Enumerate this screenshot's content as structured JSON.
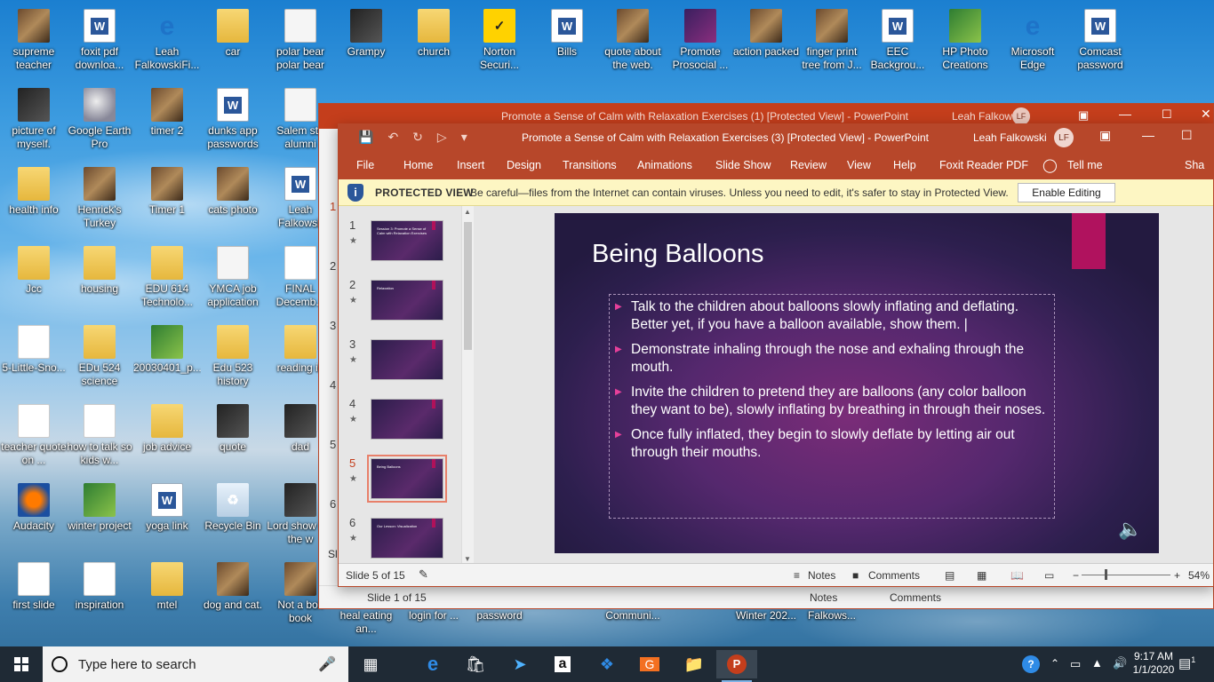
{
  "desktop_icons": [
    {
      "label": "supreme teacher",
      "type": "photo"
    },
    {
      "label": "foxit pdf downloa...",
      "type": "word"
    },
    {
      "label": "Leah FalkowskiFi...",
      "type": "edge"
    },
    {
      "label": "car",
      "type": "folder"
    },
    {
      "label": "polar bear polar bear",
      "type": "doc"
    },
    {
      "label": "Grampy",
      "type": "dark"
    },
    {
      "label": "church",
      "type": "folder"
    },
    {
      "label": "Norton Securi...",
      "type": "norton"
    },
    {
      "label": "Bills",
      "type": "word"
    },
    {
      "label": "quote about the web.",
      "type": "photo"
    },
    {
      "label": "Promote Prosocial ...",
      "type": "ppt"
    },
    {
      "label": "action packed",
      "type": "photo"
    },
    {
      "label": "finger print tree from J...",
      "type": "photo"
    },
    {
      "label": "EEC Backgrou...",
      "type": "word"
    },
    {
      "label": "HP Photo Creations",
      "type": "green"
    },
    {
      "label": "Microsoft Edge",
      "type": "edge"
    },
    {
      "label": "Comcast password",
      "type": "word"
    },
    {
      "label": "picture of myself.",
      "type": "dark"
    },
    {
      "label": "Google Earth Pro",
      "type": "earth"
    },
    {
      "label": "timer 2",
      "type": "photo"
    },
    {
      "label": "dunks app passwords",
      "type": "word"
    },
    {
      "label": "Salem sta alumni",
      "type": "doc"
    },
    {
      "label": "health info",
      "type": "folder"
    },
    {
      "label": "Henrick's Turkey",
      "type": "photo"
    },
    {
      "label": "Timer 1",
      "type": "photo"
    },
    {
      "label": "cats photo",
      "type": "photo"
    },
    {
      "label": "Leah Falkowsk",
      "type": "word"
    },
    {
      "label": "Jcc",
      "type": "folder"
    },
    {
      "label": "housing",
      "type": "folder"
    },
    {
      "label": "EDU 614 Technolo...",
      "type": "folder"
    },
    {
      "label": "YMCA job application",
      "type": "doc"
    },
    {
      "label": "FINAL Decemb...",
      "type": "white"
    },
    {
      "label": "5-Little-Sno...",
      "type": "white"
    },
    {
      "label": "EDu 524 science",
      "type": "folder"
    },
    {
      "label": "20030401_p...",
      "type": "green"
    },
    {
      "label": "Edu 523 history",
      "type": "folder"
    },
    {
      "label": "reading in",
      "type": "folder"
    },
    {
      "label": "teacher quote on ...",
      "type": "white"
    },
    {
      "label": "how to talk so kids w...",
      "type": "white"
    },
    {
      "label": "job advice",
      "type": "folder"
    },
    {
      "label": "quote",
      "type": "dark"
    },
    {
      "label": "dad",
      "type": "dark"
    },
    {
      "label": "Audacity",
      "type": "audacity"
    },
    {
      "label": "winter project",
      "type": "green"
    },
    {
      "label": "yoga link",
      "type": "word"
    },
    {
      "label": "Recycle Bin",
      "type": "bin"
    },
    {
      "label": "Lord show me the w",
      "type": "dark"
    },
    {
      "label": "first slide",
      "type": "white"
    },
    {
      "label": "inspiration",
      "type": "white"
    },
    {
      "label": "mtel",
      "type": "folder"
    },
    {
      "label": "dog and cat.",
      "type": "photo"
    },
    {
      "label": "Not a box book",
      "type": "photo"
    }
  ],
  "partial_icon_labels": [
    {
      "label": "heal eating an..."
    },
    {
      "label": "login for ..."
    },
    {
      "label": "password"
    },
    {
      "label": "Communi..."
    },
    {
      "label": "Winter 202..."
    },
    {
      "label": "Falkows..."
    }
  ],
  "back_window": {
    "title": "Promote a Sense of Calm with Relaxation Exercises (1) [Protected View]  -  PowerPoint",
    "user": "Leah Falkowski",
    "initials": "LF",
    "status_slide": "Slide 1 of 15",
    "notes": "Notes",
    "comments": "Comments",
    "thumb_numbers": [
      "1",
      "2",
      "3",
      "4",
      "5",
      "6"
    ],
    "side_label": "Slic"
  },
  "window": {
    "title": "Promote a Sense of Calm with Relaxation Exercises (3) [Protected View]  -  PowerPoint",
    "user": "Leah Falkowski",
    "initials": "LF",
    "menu": [
      "File",
      "Home",
      "Insert",
      "Design",
      "Transitions",
      "Animations",
      "Slide Show",
      "Review",
      "View",
      "Help",
      "Foxit Reader PDF",
      "Tell me",
      "Sha"
    ],
    "protected_view": {
      "label": "PROTECTED VIEW",
      "message": "Be careful—files from the Internet can contain viruses. Unless you need to edit, it's safer to stay in Protected View.",
      "button": "Enable Editing"
    },
    "thumbnails": [
      {
        "num": "1",
        "selected": false,
        "caption": "Session 3: Promote a Sense of Calm with Relaxation Exercises"
      },
      {
        "num": "2",
        "selected": false,
        "caption": "Relaxation"
      },
      {
        "num": "3",
        "selected": false,
        "caption": ""
      },
      {
        "num": "4",
        "selected": false,
        "caption": ""
      },
      {
        "num": "5",
        "selected": true,
        "caption": "Being Balloons"
      },
      {
        "num": "6",
        "selected": false,
        "caption": "Our Lesson: Visualization"
      }
    ],
    "slide": {
      "title": "Being Balloons",
      "bullets": [
        "Talk to the children about balloons slowly inflating and deflating. Better yet, if you have a balloon available, show them. |",
        "Demonstrate inhaling through the nose and exhaling through the mouth.",
        "Invite the children to pretend they are balloons (any color balloon they want to be), slowly inflating by breathing in through their noses.",
        "Once fully inflated, they begin to slowly deflate by letting air out through their mouths."
      ]
    },
    "status": {
      "slide": "Slide 5 of 15",
      "notes": "Notes",
      "comments": "Comments",
      "zoom": "54%"
    }
  },
  "taskbar": {
    "search_placeholder": "Type here to search",
    "time": "9:17 AM",
    "date": "1/1/2020",
    "notification_count": "1"
  }
}
